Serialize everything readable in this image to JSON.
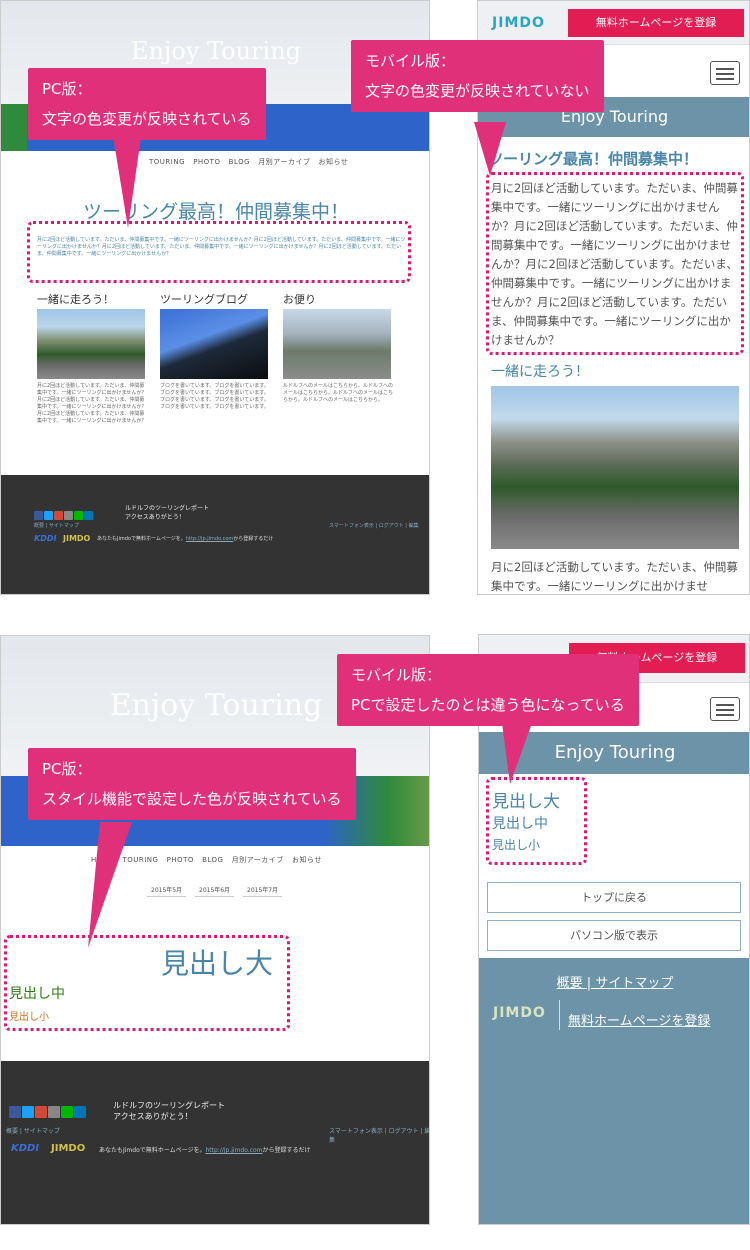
{
  "pc1": {
    "site_title": "Enjoy Touring",
    "nav": [
      "TOURING",
      "PHOTO",
      "BLOG",
      "月別アーカイブ",
      "お知らせ"
    ],
    "heading": "ツーリング最高！仲間募集中！",
    "intro": "月に2回ほど活動しています。ただいま、仲間募集中です。一緒にツーリングに出かけませんか？月に2回ほど活動しています。ただいま、仲間募集中です。一緒にツーリングに出かけませんか？月に2回ほど活動しています。ただいま、仲間募集中です。一緒にツーリングに出かけませんか？月に2回ほど活動しています。ただいま、仲間募集中です。一緒にツーリングに出かけませんか？",
    "cols": [
      {
        "title": "一緒に走ろう！",
        "text": "月に2回ほど活動しています。ただいま、仲間募集中です。一緒にツーリングに出かけませんか？月に2回ほど活動しています。ただいま、仲間募集中です。一緒にツーリングに出かけませんか？月に2回ほど活動しています。ただいま、仲間募集中です。一緒にツーリングに出かけませんか？"
      },
      {
        "title": "ツーリングブログ",
        "text": "ブログを書いています。ブログを書いています。ブログを書いています。ブログを書いています。ブログを書いています。ブログを書いています。ブログを書いています。ブログを書いています。"
      },
      {
        "title": "お便り",
        "text": "ルドルフへのメールはこちらから。ルドルフへのメールはこちらから。ルドルフへのメールはこちらから。ルドルフへのメールはこちらから。"
      }
    ],
    "footer_line1": "ルドルフのツーリングレポート",
    "footer_line2": "アクセスありがとう！",
    "footer_links_left": "概要 | サイトマップ",
    "footer_links_right": "スマートフォン表示 | ログアウト | 編集",
    "footer_kddi": "KDDI",
    "footer_jimdo": "JIMDO",
    "footer_note": "あなたもJimdoで無料ホームページを。",
    "footer_url": "http://jp.jimdo.com",
    "footer_url_suffix": "から登録するだけ"
  },
  "mob1": {
    "logo": "JIMDO",
    "register_button": "無料ホームページを登録",
    "site_title": "Enjoy Touring",
    "heading": "ツーリング最高！仲間募集中！",
    "intro": "月に2回ほど活動しています。ただいま、仲間募集中です。一緒にツーリングに出かけませんか？月に2回ほど活動しています。ただいま、仲間募集中です。一緒にツーリングに出かけませんか？月に2回ほど活動しています。ただいま、仲間募集中です。一緒にツーリングに出かけませんか？月に2回ほど活動しています。ただいま、仲間募集中です。一緒にツーリングに出かけませんか？",
    "sub_heading": "一緒に走ろう！",
    "sub_text": "月に2回ほど活動しています。ただいま、仲間募集中です。一緒にツーリングに出かけませ"
  },
  "pc2": {
    "site_title": "Enjoy Touring",
    "nav": [
      "HOME",
      "TOURING",
      "PHOTO",
      "BLOG",
      "月別アーカイブ",
      "お知らせ"
    ],
    "archives": [
      "2015年5月",
      "2015年6月",
      "2015年7月"
    ],
    "h_large": "見出し大",
    "h_medium": "見出し中",
    "h_small": "見出し小",
    "footer_line1": "ルドルフのツーリングレポート",
    "footer_line2": "アクセスありがとう！",
    "footer_links_left": "概要 | サイトマップ",
    "footer_links_right": "スマートフォン表示 | ログアウト | 編集",
    "footer_kddi": "KDDI",
    "footer_jimdo": "JIMDO",
    "footer_note": "あなたもJimdoで無料ホームページを。",
    "footer_url": "http://jp.jimdo.com",
    "footer_url_suffix": "から登録するだけ"
  },
  "mob2": {
    "register_button": "無料ホームページを登録",
    "site_title": "Enjoy Touring",
    "h_large": "見出し大",
    "h_medium": "見出し中",
    "h_small": "見出し小",
    "btn_top": "トップに戻る",
    "btn_pc": "パソコン版で表示",
    "footer_links": "概要 | サイトマップ",
    "footer_logo": "JIMDO",
    "footer_register": "無料ホームページを登録"
  },
  "callouts": {
    "c1": [
      "PC版：",
      "文字の色変更が反映されている"
    ],
    "c2": [
      "モバイル版：",
      "文字の色変更が反映されていない"
    ],
    "c3": [
      "PC版：",
      "スタイル機能で設定した色が反映されている"
    ],
    "c4": [
      "モバイル版：",
      "PCで設定したのとは違う色になっている"
    ]
  },
  "colors": {
    "accent": "#e0307a",
    "dots": "#d81b78",
    "mobile_bar": "#6d93a8",
    "pc_heading": "#4a86a8",
    "pc_h_medium": "#2e7d12",
    "pc_h_small": "#c8731e",
    "footer_bg": "#333333"
  }
}
